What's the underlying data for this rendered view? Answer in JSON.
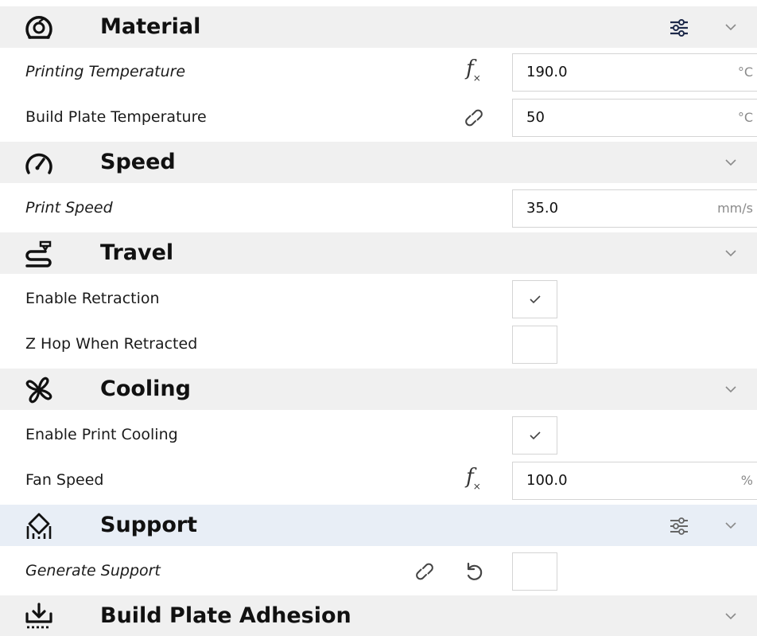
{
  "categories": {
    "material": {
      "title": "Material",
      "icon": "material-spool-icon"
    },
    "speed": {
      "title": "Speed",
      "icon": "speedometer-icon"
    },
    "travel": {
      "title": "Travel",
      "icon": "travel-path-icon"
    },
    "cooling": {
      "title": "Cooling",
      "icon": "fan-icon"
    },
    "support": {
      "title": "Support",
      "icon": "support-icon"
    },
    "adhesion": {
      "title": "Build Plate Adhesion",
      "icon": "build-plate-download-icon"
    }
  },
  "settings": {
    "printing_temperature": {
      "label": "Printing Temperature",
      "value": "190.0",
      "unit": "°C"
    },
    "build_plate_temperature": {
      "label": "Build Plate Temperature",
      "value": "50",
      "unit": "°C"
    },
    "print_speed": {
      "label": "Print Speed",
      "value": "35.0",
      "unit": "mm/s"
    },
    "enable_retraction": {
      "label": "Enable Retraction",
      "checked": true
    },
    "z_hop": {
      "label": "Z Hop When Retracted",
      "checked": false
    },
    "enable_print_cooling": {
      "label": "Enable Print Cooling",
      "checked": true
    },
    "fan_speed": {
      "label": "Fan Speed",
      "value": "100.0",
      "unit": "%"
    },
    "generate_support": {
      "label": "Generate Support",
      "checked": false
    }
  },
  "icons": {
    "function": "fx-icon",
    "link": "link-icon",
    "reset": "reset-icon",
    "settings_visibility": "tune-icon",
    "collapse": "chevron-down-icon",
    "check": "check-icon"
  },
  "colors": {
    "category_bg": "#f0f0f0",
    "category_hover_bg": "#e8eef6",
    "tune_active": "#1e2a4a",
    "icon_gray": "#555555"
  }
}
